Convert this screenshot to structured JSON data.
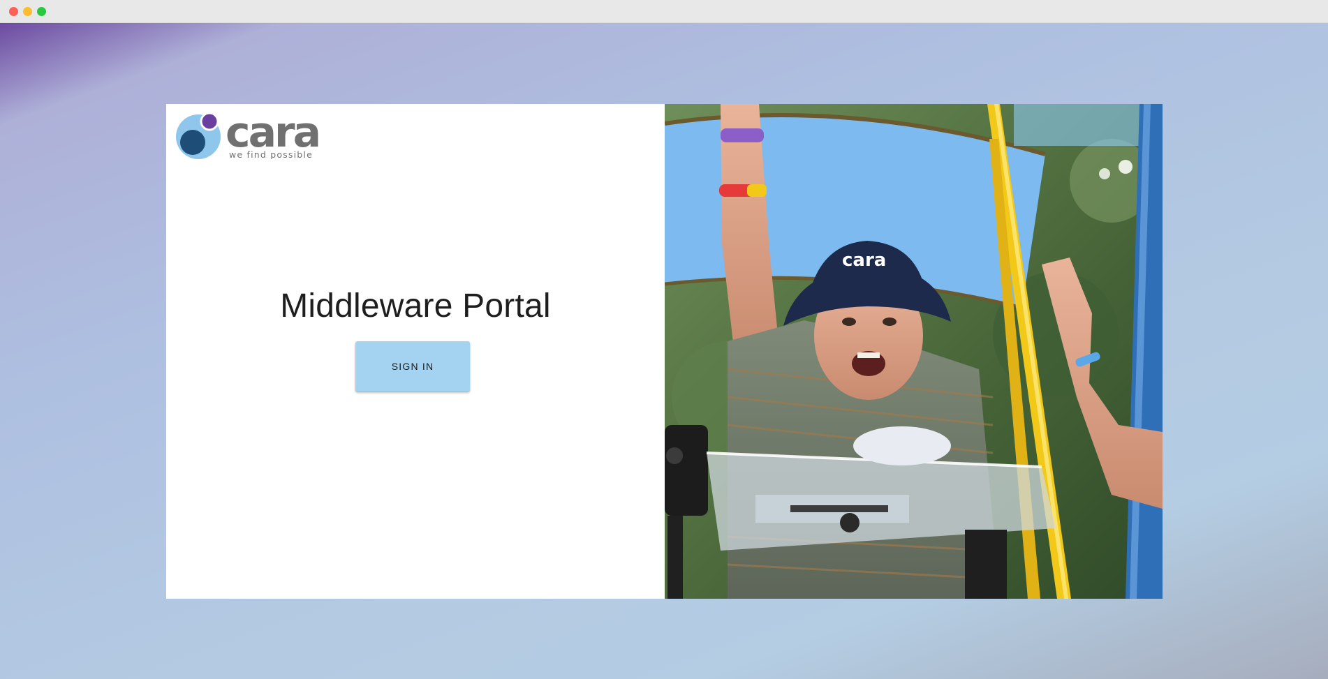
{
  "window": {
    "controls": [
      "close",
      "minimize",
      "maximize"
    ]
  },
  "colors": {
    "brand_purple": "#6b3fa0",
    "brand_blue_dark": "#1e4d78",
    "brand_blue_light": "#8fc6ec",
    "logo_grey": "#707070",
    "button_bg": "#a3d3f0",
    "tray_yellow": "#f2c819"
  },
  "logo": {
    "wordmark": "cara",
    "tagline": "we find possible"
  },
  "hero": {
    "title": "Middleware Portal",
    "sign_in_label": "SIGN IN"
  },
  "photo": {
    "hat_text": "cara"
  },
  "icons": {
    "logo_mark": "cara-circles-logo-icon"
  }
}
